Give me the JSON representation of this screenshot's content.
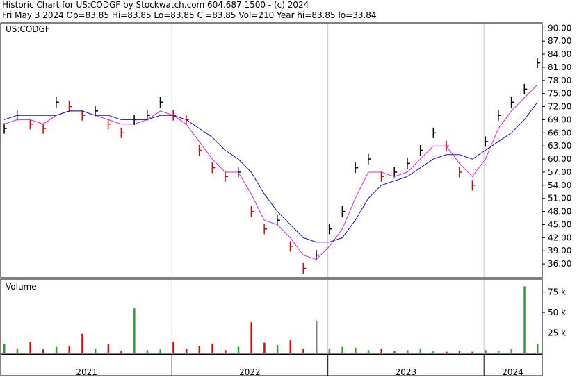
{
  "header": {
    "line1": "Historic Chart for US:CODGF by Stockwatch.com 604.687.1500 - (c) 2024",
    "line2": "Fri May  3 2024   Op=83.85  Hi=83.85  Lo=83.85  Cl=83.85  Vol=210  Year hi=83.85  lo=33.84"
  },
  "colors": {
    "up_bar": "#000000",
    "down_bar": "#e00000",
    "ma_short": "#e020e0",
    "ma_long": "#1010c0",
    "vol_up": "#2aa02a",
    "vol_down": "#e00000",
    "vol_unchanged": "#808080"
  },
  "chart_data": [
    {
      "type": "line",
      "title": "US:CODGF",
      "ylim": [
        33,
        91
      ],
      "y_ticks": [
        "90.00",
        "87.00",
        "84.00",
        "81.00",
        "78.00",
        "75.00",
        "72.00",
        "69.00",
        "66.00",
        "63.00",
        "60.00",
        "57.00",
        "54.00",
        "51.00",
        "48.00",
        "45.00",
        "42.00",
        "39.00",
        "36.00"
      ],
      "x_ticks": [
        "2021",
        "2022",
        "2023",
        "2024"
      ],
      "series": [
        {
          "name": "",
          "role": "price",
          "x": [
            "2020-12",
            "2021-01",
            "2021-02",
            "2021-03",
            "2021-04",
            "2021-05",
            "2021-06",
            "2021-07",
            "2021-08",
            "2021-09",
            "2021-10",
            "2021-11",
            "2021-12",
            "2022-01",
            "2022-02",
            "2022-03",
            "2022-04",
            "2022-05",
            "2022-06",
            "2022-07",
            "2022-08",
            "2022-09",
            "2022-10",
            "2022-11",
            "2022-12",
            "2023-01",
            "2023-02",
            "2023-03",
            "2023-04",
            "2023-05",
            "2023-06",
            "2023-07",
            "2023-08",
            "2023-09",
            "2023-10",
            "2023-11",
            "2023-12",
            "2024-01",
            "2024-02",
            "2024-03",
            "2024-04",
            "2024-05"
          ],
          "values": [
            67,
            70,
            68,
            67,
            73,
            72,
            70,
            71,
            68,
            66,
            69,
            70,
            73,
            70,
            69,
            62,
            58,
            56,
            57,
            48,
            44,
            46,
            40,
            35,
            38,
            44,
            48,
            58,
            60,
            56,
            57,
            59,
            62,
            66,
            63,
            57,
            54,
            64,
            70,
            73,
            76,
            82
          ]
        },
        {
          "name": "",
          "role": "ma_short",
          "values": [
            68,
            69,
            69,
            68,
            70,
            71,
            71,
            70,
            69,
            68,
            68,
            69,
            71,
            70,
            68,
            64,
            60,
            57,
            57,
            52,
            46,
            45,
            42,
            38,
            37,
            40,
            44,
            51,
            57,
            57,
            56,
            57,
            60,
            63,
            63,
            59,
            56,
            60,
            67,
            71,
            74,
            77
          ]
        },
        {
          "name": "",
          "role": "ma_long",
          "values": [
            69,
            70,
            70,
            70,
            70,
            71,
            71,
            70,
            70,
            69,
            69,
            69,
            70,
            70,
            69,
            67,
            65,
            62,
            60,
            57,
            52,
            48,
            45,
            42,
            41,
            41,
            42,
            46,
            51,
            54,
            55,
            56,
            58,
            60,
            61,
            61,
            60,
            62,
            64,
            66,
            69,
            73
          ]
        }
      ]
    },
    {
      "type": "bar",
      "title": "Volume",
      "ylim": [
        0,
        90
      ],
      "y_ticks": [
        "75 k",
        "50 k",
        "25 k"
      ],
      "categories": [
        "2020-12",
        "2021-01",
        "2021-02",
        "2021-03",
        "2021-04",
        "2021-05",
        "2021-06",
        "2021-07",
        "2021-08",
        "2021-09",
        "2021-10",
        "2021-11",
        "2021-12",
        "2022-01",
        "2022-02",
        "2022-03",
        "2022-04",
        "2022-05",
        "2022-06",
        "2022-07",
        "2022-08",
        "2022-09",
        "2022-10",
        "2022-11",
        "2022-12",
        "2023-01",
        "2023-02",
        "2023-03",
        "2023-04",
        "2023-05",
        "2023-06",
        "2023-07",
        "2023-08",
        "2023-09",
        "2023-10",
        "2023-11",
        "2023-12",
        "2024-01",
        "2024-02",
        "2024-03",
        "2024-04",
        "2024-05"
      ],
      "values": [
        12,
        6,
        14,
        5,
        8,
        9,
        24,
        6,
        11,
        3,
        55,
        4,
        5,
        14,
        6,
        9,
        12,
        4,
        8,
        38,
        13,
        10,
        16,
        6,
        40,
        5,
        8,
        7,
        4,
        6,
        3,
        4,
        6,
        3,
        2,
        3,
        2,
        4,
        3,
        5,
        82,
        12
      ]
    }
  ]
}
